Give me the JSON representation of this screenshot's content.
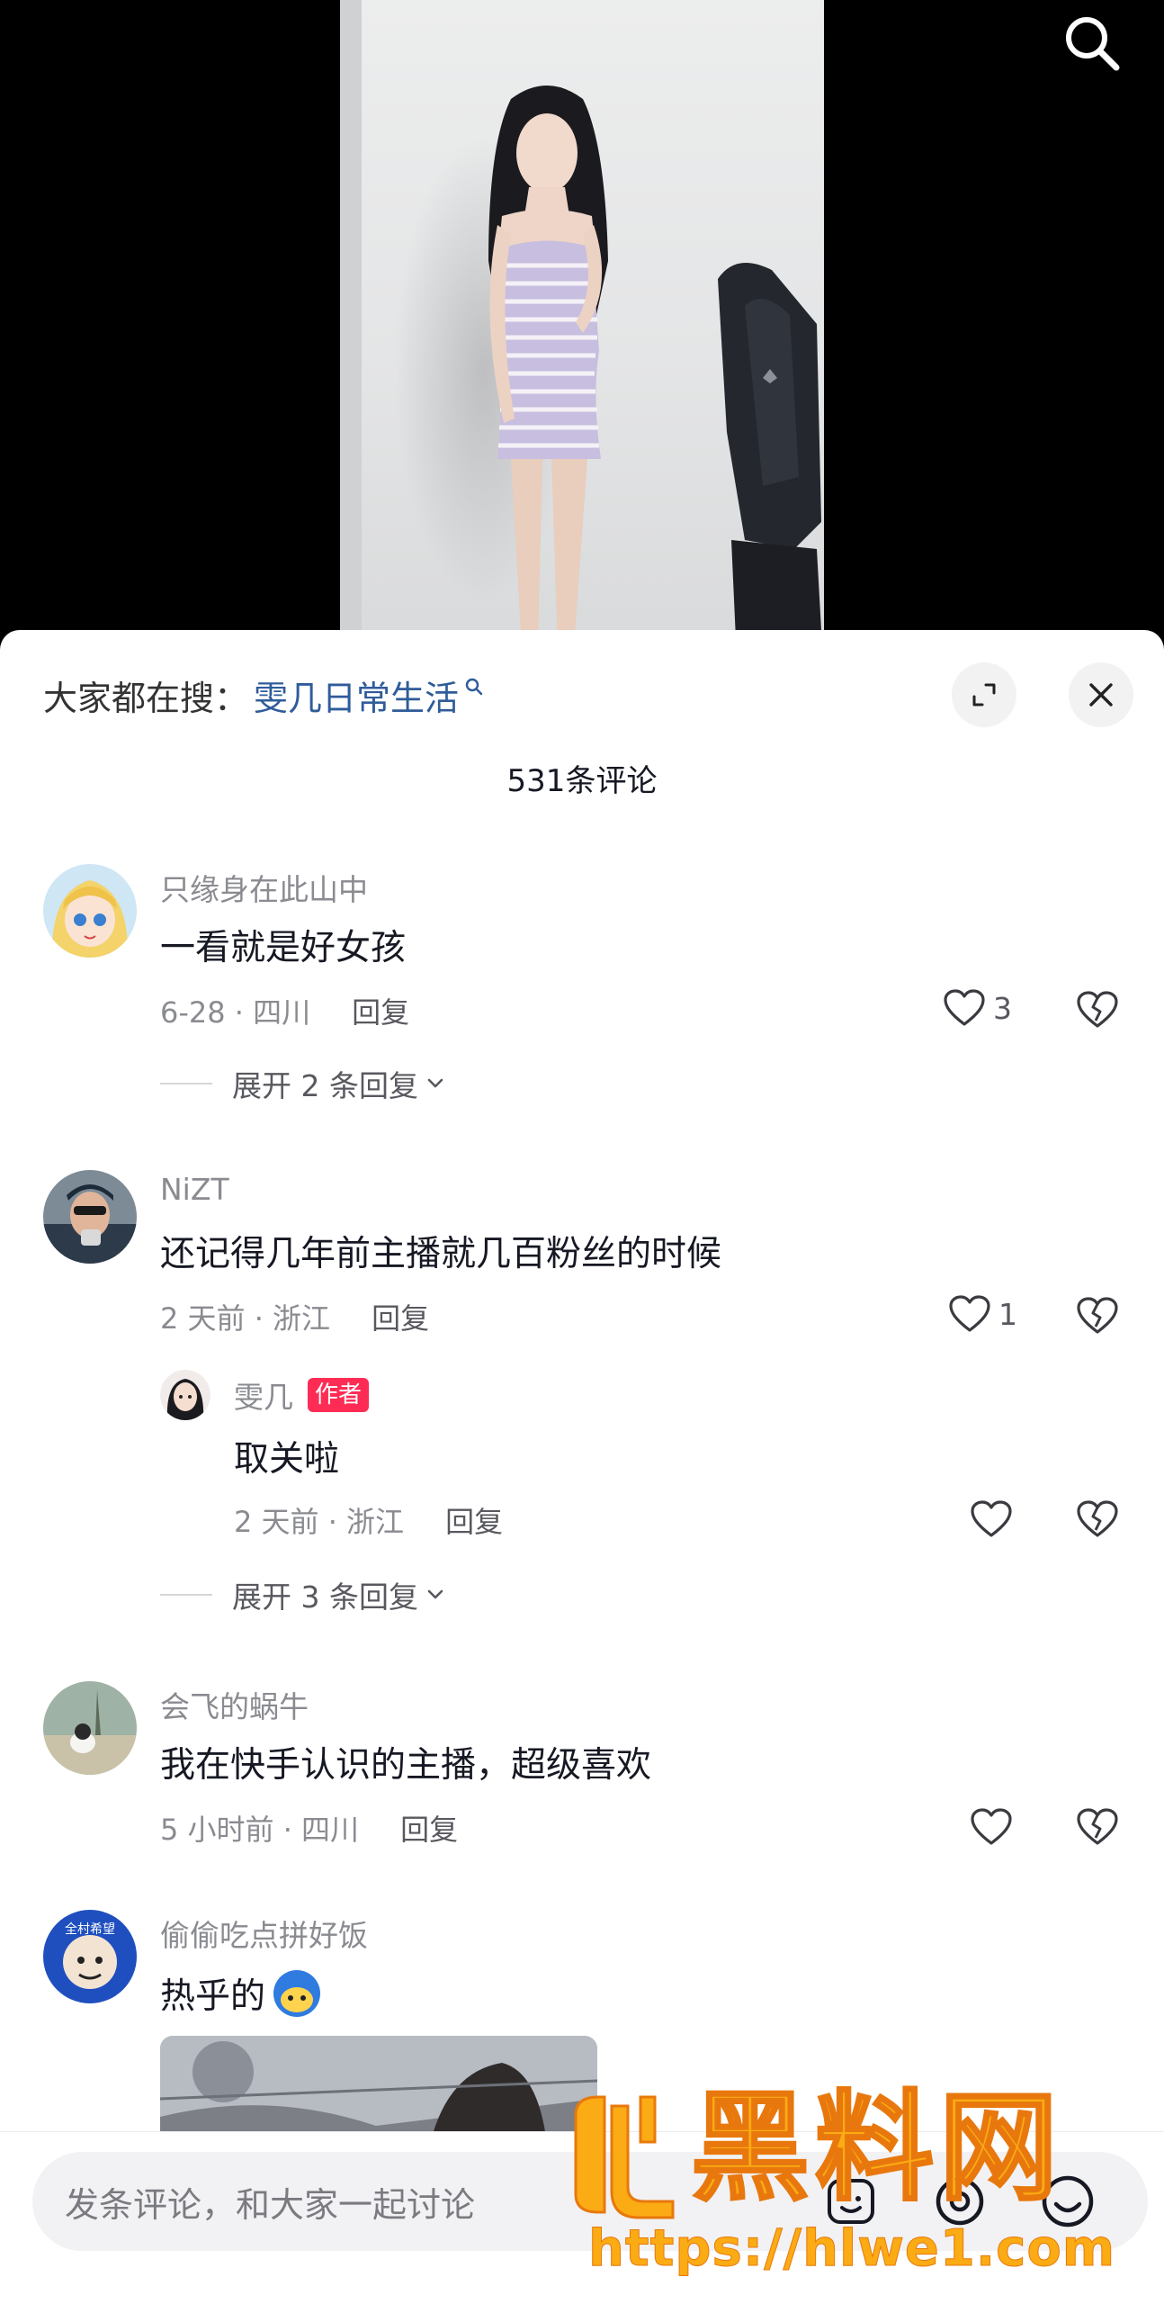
{
  "video": {
    "top_icon": "search-icon"
  },
  "sheet": {
    "hot_search_prefix": "大家都在搜：",
    "hot_search_keyword": "雯几日常生活",
    "expand_icon": "expand-icon",
    "close_icon": "close-icon",
    "comment_count": "531条评论"
  },
  "comments": [
    {
      "username": "只缘身在此山中",
      "text": "一看就是好女孩",
      "date": "6-28 · 四川",
      "reply_label": "回复",
      "likes": "3",
      "expand_label": "展开 2 条回复"
    },
    {
      "username": "NiZT",
      "text": "还记得几年前主播就几百粉丝的时候",
      "date": "2 天前 · 浙江",
      "reply_label": "回复",
      "likes": "1",
      "reply": {
        "username": "雯几",
        "badge": "作者",
        "text": "取关啦",
        "date": "2 天前 · 浙江",
        "reply_label": "回复"
      },
      "expand_label": "展开 3 条回复"
    },
    {
      "username": "会飞的蜗牛",
      "text": "我在快手认识的主播，超级喜欢",
      "date": "5 小时前 · 四川",
      "reply_label": "回复"
    },
    {
      "username": "偷偷吃点拼好饭",
      "text": "热乎的",
      "avatar_text": "全村希望"
    }
  ],
  "bottom": {
    "input_placeholder": "发条评论，和大家一起讨论",
    "icons": [
      "emoji-icon",
      "at-icon",
      "smile-icon"
    ]
  },
  "watermark": {
    "brand": "黑料网",
    "url": "https://hlwe1.com"
  },
  "colors": {
    "accent": "#fe2c55",
    "keyword": "#2f5c9a",
    "watermark": "#fbab14"
  }
}
